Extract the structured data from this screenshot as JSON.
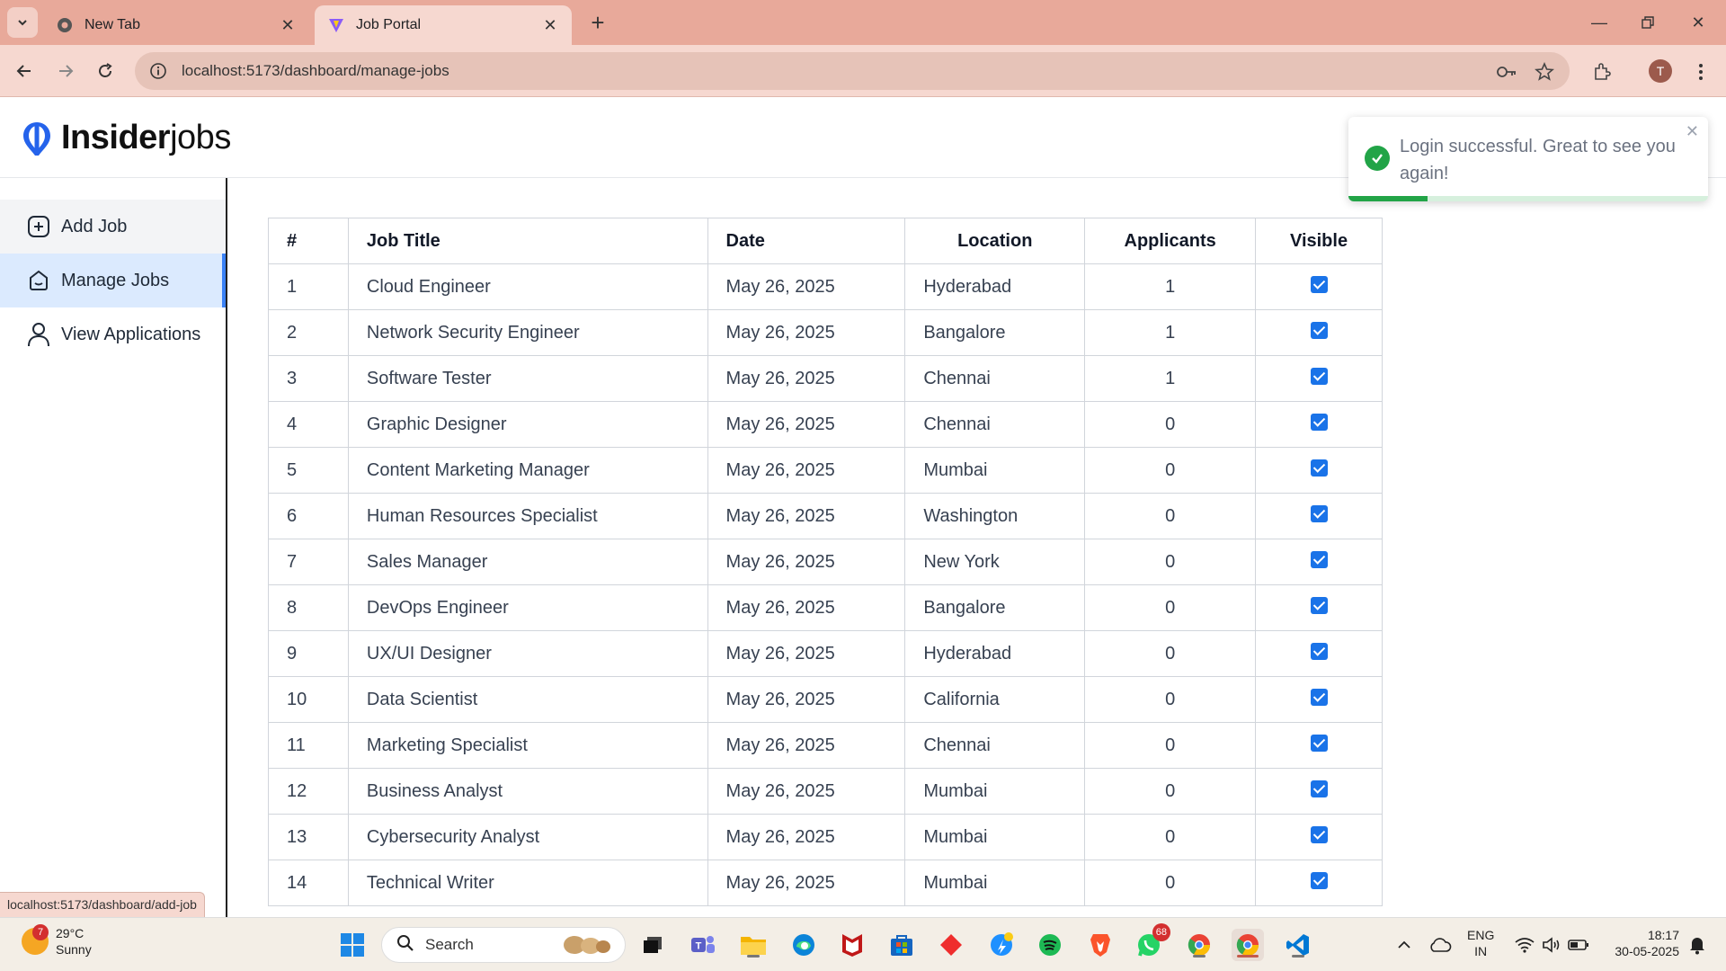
{
  "browser": {
    "tabs": [
      {
        "title": "New Tab"
      },
      {
        "title": "Job Portal"
      }
    ],
    "url": "localhost:5173/dashboard/manage-jobs",
    "profile_initial": "T",
    "status_url": "localhost:5173/dashboard/add-job"
  },
  "app": {
    "logo_bold": "Insider",
    "logo_light": "jobs"
  },
  "sidebar": {
    "items": [
      {
        "label": "Add Job"
      },
      {
        "label": "Manage Jobs"
      },
      {
        "label": "View Applications"
      }
    ]
  },
  "table": {
    "headers": [
      "#",
      "Job Title",
      "Date",
      "Location",
      "Applicants",
      "Visible"
    ],
    "rows": [
      {
        "num": "1",
        "title": "Cloud Engineer",
        "date": "May 26, 2025",
        "location": "Hyderabad",
        "applicants": "1",
        "visible": true
      },
      {
        "num": "2",
        "title": "Network Security Engineer",
        "date": "May 26, 2025",
        "location": "Bangalore",
        "applicants": "1",
        "visible": true
      },
      {
        "num": "3",
        "title": "Software Tester",
        "date": "May 26, 2025",
        "location": "Chennai",
        "applicants": "1",
        "visible": true
      },
      {
        "num": "4",
        "title": "Graphic Designer",
        "date": "May 26, 2025",
        "location": "Chennai",
        "applicants": "0",
        "visible": true
      },
      {
        "num": "5",
        "title": "Content Marketing Manager",
        "date": "May 26, 2025",
        "location": "Mumbai",
        "applicants": "0",
        "visible": true
      },
      {
        "num": "6",
        "title": "Human Resources Specialist",
        "date": "May 26, 2025",
        "location": "Washington",
        "applicants": "0",
        "visible": true
      },
      {
        "num": "7",
        "title": "Sales Manager",
        "date": "May 26, 2025",
        "location": "New York",
        "applicants": "0",
        "visible": true
      },
      {
        "num": "8",
        "title": "DevOps Engineer",
        "date": "May 26, 2025",
        "location": "Bangalore",
        "applicants": "0",
        "visible": true
      },
      {
        "num": "9",
        "title": "UX/UI Designer",
        "date": "May 26, 2025",
        "location": "Hyderabad",
        "applicants": "0",
        "visible": true
      },
      {
        "num": "10",
        "title": "Data Scientist",
        "date": "May 26, 2025",
        "location": "California",
        "applicants": "0",
        "visible": true
      },
      {
        "num": "11",
        "title": "Marketing Specialist",
        "date": "May 26, 2025",
        "location": "Chennai",
        "applicants": "0",
        "visible": true
      },
      {
        "num": "12",
        "title": "Business Analyst",
        "date": "May 26, 2025",
        "location": "Mumbai",
        "applicants": "0",
        "visible": true
      },
      {
        "num": "13",
        "title": "Cybersecurity Analyst",
        "date": "May 26, 2025",
        "location": "Mumbai",
        "applicants": "0",
        "visible": true
      },
      {
        "num": "14",
        "title": "Technical Writer",
        "date": "May 26, 2025",
        "location": "Mumbai",
        "applicants": "0",
        "visible": true
      }
    ]
  },
  "toast": {
    "message": "Login successful. Great to see you again!",
    "progress": 0.22,
    "color": "#22a447"
  },
  "taskbar": {
    "weather_badge": "7",
    "temperature": "29°C",
    "condition": "Sunny",
    "search_label": "Search",
    "whatsapp_badge": "68",
    "lang_line1": "ENG",
    "lang_line2": "IN",
    "time": "18:17",
    "date": "30-05-2025"
  },
  "colors": {
    "tab_bar": "#e8a99a",
    "toolbar": "#f6d8d0",
    "accent": "#3b82f6",
    "active_nav_bg": "#dbeafe",
    "checkbox": "#1a73e8"
  }
}
